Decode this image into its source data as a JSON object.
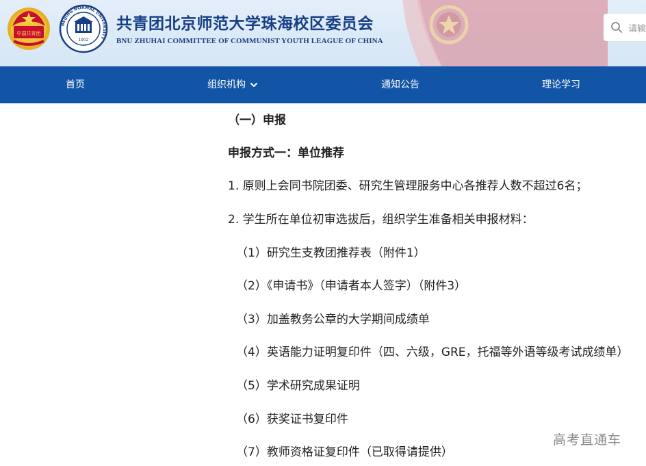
{
  "header": {
    "title_cn": "共青团北京师范大学珠海校区委员会",
    "title_en": "BNU ZHUHAI COMMITTEE OF COMMUNIST YOUTH LEAGUE OF CHINA",
    "logo_bnu_ring": "BEIJING NORMAL UNIVERSITY",
    "logo_bnu_year": "1902",
    "logo_cyl_text": "中国共青团",
    "search": {
      "placeholder": "请输"
    }
  },
  "nav": {
    "items": [
      {
        "label": "首页"
      },
      {
        "label": "组织机构",
        "has_dropdown": true
      },
      {
        "label": "通知公告"
      },
      {
        "label": "理论学习"
      }
    ]
  },
  "content": {
    "heading": "（一）申报",
    "method_title": "申报方式一：单位推荐",
    "points": [
      "1. 原则上会同书院团委、研究生管理服务中心各推荐人数不超过6名；",
      "2. 学生所在单位初审选拔后，组织学生准备相关申报材料："
    ],
    "materials": [
      "（1）研究生支教团推荐表（附件1）",
      "（2）《申请书》（申请者本人签字）（附件3）",
      "（3）加盖教务公章的大学期间成绩单",
      "（4）英语能力证明复印件（四、六级，GRE，托福等外语等级考试成绩单）",
      "（5）学术研究成果证明",
      "（6）获奖证书复印件",
      "（7）教师资格证复印件（已取得请提供）"
    ]
  },
  "watermark": "高考直通车",
  "colors": {
    "nav_bg": "#1255a6",
    "header_bg": "#dbe8f6",
    "title_blue": "#173f85",
    "flag_red": "#c8102e"
  }
}
